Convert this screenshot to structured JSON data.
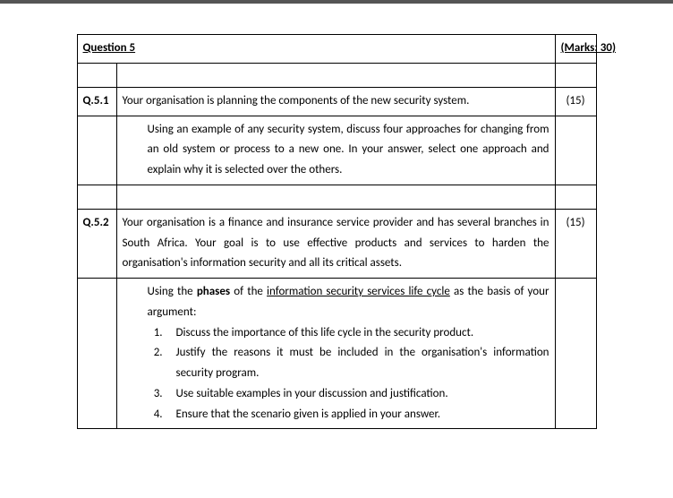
{
  "header": {
    "title": "Question 5",
    "marks_label": "(Marks: 30)"
  },
  "q51": {
    "id": "Q.5.1",
    "intro": "Your organisation is planning the components of the new security system.",
    "marks": "(15)",
    "body": "Using an example of any security system, discuss four approaches for changing from an old system or process to a new one. In your answer, select one approach and explain why it is selected over the others."
  },
  "q52": {
    "id": "Q.5.2",
    "intro": "Your organisation is a finance and insurance service provider and has several branches in South Africa. Your goal is to use effective products and services to harden the organisation's information security and all its critical assets.",
    "marks": "(15)",
    "lead_pre": "Using the ",
    "lead_bold": "phases",
    "lead_mid": " of the ",
    "lead_uline": "information security services life cycle",
    "lead_post": " as the basis of your argument:",
    "items": [
      "Discuss the importance of this life cycle in the security product.",
      "Justify the reasons it must be included in the organisation's information security program.",
      "Use suitable examples in your discussion and justification.",
      "Ensure that the scenario given is applied in your answer."
    ]
  }
}
